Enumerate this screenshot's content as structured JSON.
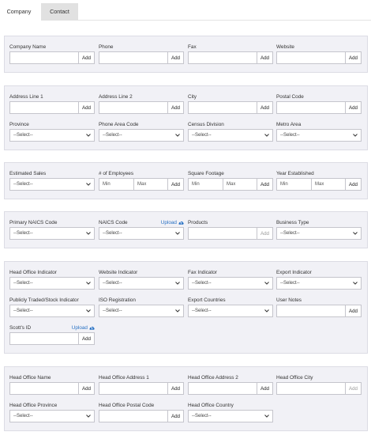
{
  "tabs": [
    {
      "label": "Company"
    },
    {
      "label": "Contact"
    }
  ],
  "common": {
    "add": "Add",
    "select": "--Select--",
    "min": "Min",
    "max": "Max",
    "upload": "Upload"
  },
  "company": {
    "name": "Company Name",
    "phone": "Phone",
    "fax": "Fax",
    "website": "Website"
  },
  "address": {
    "line1": "Address Line 1",
    "line2": "Address Line 2",
    "city": "City",
    "postal": "Postal Code",
    "province": "Province",
    "phone_area": "Phone Area Code",
    "census": "Census Division",
    "metro": "Metro Area"
  },
  "metrics": {
    "sales": "Estimated Sales",
    "employees": "# of Employees",
    "sqft": "Square Footage",
    "year": "Year Established"
  },
  "industry": {
    "naics_primary": "Primary NAICS Code",
    "naics": "NAICS Code",
    "products": "Products",
    "business_type": "Business Type"
  },
  "indicators": {
    "head_office": "Head Office Indicator",
    "website": "Website Indicator",
    "fax": "Fax Indicator",
    "export": "Export Indicator",
    "traded": "Publicly Traded/Stock Indicator",
    "iso": "ISO Registration",
    "export_countries": "Export Countries",
    "notes": "User Notes",
    "scotts_id": "Scott's ID"
  },
  "head_office": {
    "name": "Head Office Name",
    "address1": "Head Office Address 1",
    "address2": "Head Office Address 2",
    "city": "Head Office City",
    "province": "Head Office Province",
    "postal": "Head Office Postal Code",
    "country": "Head Office Country"
  }
}
